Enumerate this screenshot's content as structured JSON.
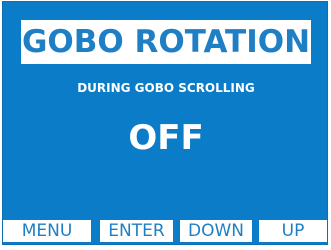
{
  "screen": {
    "title": "GOBO ROTATION",
    "subtitle": "DURING GOBO SCROLLING",
    "value": "OFF"
  },
  "softkeys": {
    "menu": "MENU",
    "enter": "ENTER",
    "down": "DOWN",
    "up": "UP"
  },
  "colors": {
    "background": "#0a7cc8",
    "title_text": "#1f7fc4",
    "panel": "#ffffff"
  }
}
